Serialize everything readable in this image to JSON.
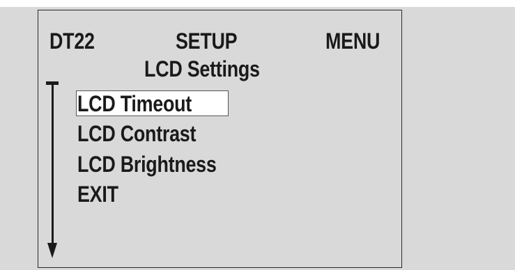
{
  "device": {
    "model": "DT22",
    "screen_title": "SETUP",
    "screen_type": "MENU",
    "submenu_title": "LCD Settings"
  },
  "menu": {
    "selected_index": 0,
    "items": [
      {
        "label": "LCD Timeout"
      },
      {
        "label": "LCD Contrast"
      },
      {
        "label": "LCD Brightness"
      },
      {
        "label": "EXIT"
      }
    ]
  },
  "scroll_indicator": {
    "icon": "scroll-down-arrow-icon"
  },
  "colors": {
    "background": "#d9d9d9",
    "text": "#1a1a1a",
    "selection": "#ffffff"
  }
}
